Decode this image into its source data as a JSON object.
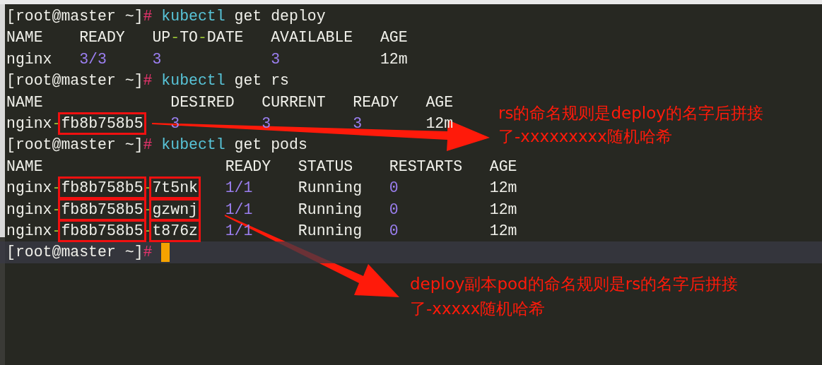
{
  "terminal": {
    "blocks": [
      {
        "kind": "command",
        "prompt": "[root@master ~]",
        "sign": "#",
        "program": "kubectl",
        "args": [
          "get",
          "deploy"
        ]
      },
      {
        "kind": "table",
        "columns": [
          {
            "text": "NAME"
          },
          {
            "text": "READY"
          },
          {
            "parts": [
              {
                "text": "UP"
              },
              {
                "text": "-",
                "kind": "dash"
              },
              {
                "text": "TO"
              },
              {
                "text": "-",
                "kind": "dash"
              },
              {
                "text": "DATE"
              }
            ]
          },
          {
            "text": "AVAILABLE"
          },
          {
            "text": "AGE"
          }
        ],
        "rows": [
          [
            {
              "text": "nginx"
            },
            {
              "text": "3/3",
              "kind": "number"
            },
            {
              "text": "3",
              "kind": "number"
            },
            {
              "text": "3",
              "kind": "number"
            },
            {
              "text": "12m"
            }
          ]
        ]
      },
      {
        "kind": "command",
        "prompt": "[root@master ~]",
        "sign": "#",
        "program": "kubectl",
        "args": [
          "get",
          "rs"
        ]
      },
      {
        "kind": "table",
        "columns": [
          {
            "text": "NAME"
          },
          {
            "text": "DESIRED"
          },
          {
            "text": "CURRENT"
          },
          {
            "text": "READY"
          },
          {
            "text": "AGE"
          }
        ],
        "rows": [
          [
            {
              "parts": [
                {
                  "text": "nginx"
                },
                {
                  "text": "-",
                  "kind": "dash"
                },
                {
                  "text": "fb8b758b5",
                  "boxed": true
                }
              ]
            },
            {
              "text": "3",
              "kind": "number"
            },
            {
              "text": "3",
              "kind": "number"
            },
            {
              "text": "3",
              "kind": "number"
            },
            {
              "text": "12m"
            }
          ]
        ]
      },
      {
        "kind": "command",
        "prompt": "[root@master ~]",
        "sign": "#",
        "program": "kubectl",
        "args": [
          "get",
          "pods"
        ]
      },
      {
        "kind": "table",
        "columns": [
          {
            "text": "NAME"
          },
          {
            "text": "READY"
          },
          {
            "text": "STATUS"
          },
          {
            "text": "RESTARTS"
          },
          {
            "text": "AGE"
          }
        ],
        "rows": [
          [
            {
              "parts": [
                {
                  "text": "nginx"
                },
                {
                  "text": "-",
                  "kind": "dash"
                },
                {
                  "text": "fb8b758b5",
                  "boxed": true
                },
                {
                  "text": "-",
                  "kind": "dash"
                },
                {
                  "text": "7t5nk",
                  "boxed": true
                }
              ]
            },
            {
              "text": "1/1",
              "kind": "number"
            },
            {
              "text": "Running"
            },
            {
              "text": "0",
              "kind": "number"
            },
            {
              "text": "12m"
            }
          ],
          [
            {
              "parts": [
                {
                  "text": "nginx"
                },
                {
                  "text": "-",
                  "kind": "dash"
                },
                {
                  "text": "fb8b758b5",
                  "boxed": true
                },
                {
                  "text": "-",
                  "kind": "dash"
                },
                {
                  "text": "gzwnj",
                  "boxed": true
                }
              ]
            },
            {
              "text": "1/1",
              "kind": "number"
            },
            {
              "text": "Running"
            },
            {
              "text": "0",
              "kind": "number"
            },
            {
              "text": "12m"
            }
          ],
          [
            {
              "parts": [
                {
                  "text": "nginx"
                },
                {
                  "text": "-",
                  "kind": "dash"
                },
                {
                  "text": "fb8b758b5",
                  "boxed": true
                },
                {
                  "text": "-",
                  "kind": "dash"
                },
                {
                  "text": "t876z",
                  "boxed": true
                }
              ]
            },
            {
              "text": "1/1",
              "kind": "number"
            },
            {
              "text": "Running"
            },
            {
              "text": "0",
              "kind": "number"
            },
            {
              "text": "12m"
            }
          ]
        ]
      },
      {
        "kind": "command",
        "prompt": "[root@master ~]",
        "sign": "#",
        "current": true
      }
    ]
  },
  "annotations": [
    {
      "lines": [
        "rs的命名规则是deploy的名字后拼接",
        "了-xxxxxxxxx随机哈希"
      ]
    },
    {
      "lines": [
        "deploy副本pod的命名规则是rs的名字后拼接",
        "了-xxxxx随机哈希"
      ]
    }
  ]
}
